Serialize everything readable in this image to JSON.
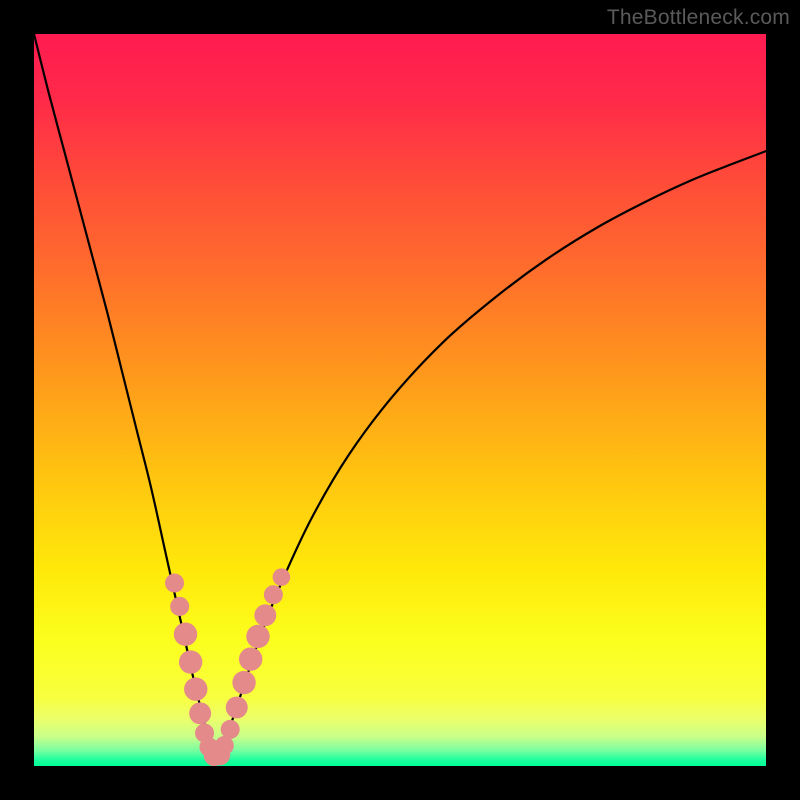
{
  "watermark": "TheBottleneck.com",
  "colors": {
    "background_black": "#000000",
    "gradient_stops": [
      {
        "offset": 0.0,
        "color": "#ff1b51"
      },
      {
        "offset": 0.09,
        "color": "#ff2a49"
      },
      {
        "offset": 0.2,
        "color": "#ff4b39"
      },
      {
        "offset": 0.33,
        "color": "#ff6f2b"
      },
      {
        "offset": 0.47,
        "color": "#ff9a1b"
      },
      {
        "offset": 0.6,
        "color": "#ffc310"
      },
      {
        "offset": 0.73,
        "color": "#ffe80a"
      },
      {
        "offset": 0.83,
        "color": "#fbff1e"
      },
      {
        "offset": 0.905,
        "color": "#f8ff3e"
      },
      {
        "offset": 0.935,
        "color": "#ecff6a"
      },
      {
        "offset": 0.96,
        "color": "#c9ff8a"
      },
      {
        "offset": 0.978,
        "color": "#7dffa0"
      },
      {
        "offset": 0.992,
        "color": "#1bff9e"
      },
      {
        "offset": 1.0,
        "color": "#00ff95"
      }
    ],
    "curve": "#000000",
    "dot_fill": "#e58a8a",
    "dot_stroke": "#e58a8a"
  },
  "chart_data": {
    "type": "line",
    "title": "",
    "xlabel": "",
    "ylabel": "",
    "xlim": [
      0,
      100
    ],
    "ylim": [
      0,
      100
    ],
    "series": [
      {
        "name": "curve",
        "x": [
          0,
          2,
          4,
          6,
          8,
          10,
          12,
          14,
          16,
          18,
          20,
          21,
          22,
          23,
          23.7,
          24.5,
          25.3,
          26.3,
          27.5,
          29,
          31,
          34,
          38,
          43,
          49,
          56,
          63,
          70,
          77,
          84,
          90,
          95,
          100
        ],
        "y": [
          100,
          92,
          84.5,
          77,
          69.5,
          62,
          54,
          46,
          38,
          29,
          20,
          15.5,
          11,
          7,
          4,
          1.5,
          1.5,
          4,
          7.5,
          12,
          18,
          25.5,
          34,
          42.5,
          50.5,
          58,
          64,
          69.2,
          73.6,
          77.3,
          80.1,
          82.1,
          84
        ]
      }
    ],
    "dots": [
      {
        "x": 19.2,
        "y": 25.0,
        "r": 1.3
      },
      {
        "x": 19.9,
        "y": 21.8,
        "r": 1.3
      },
      {
        "x": 20.7,
        "y": 18.0,
        "r": 1.6
      },
      {
        "x": 21.4,
        "y": 14.2,
        "r": 1.6
      },
      {
        "x": 22.1,
        "y": 10.5,
        "r": 1.6
      },
      {
        "x": 22.7,
        "y": 7.2,
        "r": 1.5
      },
      {
        "x": 23.3,
        "y": 4.5,
        "r": 1.3
      },
      {
        "x": 23.9,
        "y": 2.6,
        "r": 1.3
      },
      {
        "x": 24.6,
        "y": 1.4,
        "r": 1.4
      },
      {
        "x": 25.4,
        "y": 1.5,
        "r": 1.4
      },
      {
        "x": 26.0,
        "y": 2.8,
        "r": 1.3
      },
      {
        "x": 26.8,
        "y": 5.0,
        "r": 1.3
      },
      {
        "x": 27.7,
        "y": 8.0,
        "r": 1.5
      },
      {
        "x": 28.7,
        "y": 11.4,
        "r": 1.6
      },
      {
        "x": 29.6,
        "y": 14.6,
        "r": 1.6
      },
      {
        "x": 30.6,
        "y": 17.7,
        "r": 1.6
      },
      {
        "x": 31.6,
        "y": 20.6,
        "r": 1.5
      },
      {
        "x": 32.7,
        "y": 23.4,
        "r": 1.3
      },
      {
        "x": 33.8,
        "y": 25.8,
        "r": 1.2
      }
    ]
  }
}
